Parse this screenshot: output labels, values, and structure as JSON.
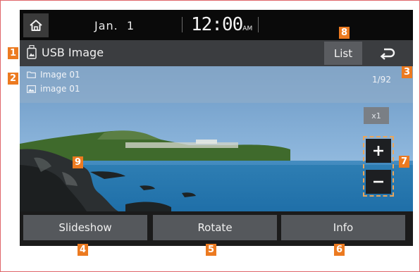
{
  "status_bar": {
    "date": "Jan.  1",
    "time": "12:00",
    "ampm": "AM"
  },
  "title_bar": {
    "title": "USB Image",
    "list_label": "List"
  },
  "file_info": {
    "folder": "Image 01",
    "image": "image 01",
    "counter": "1/92"
  },
  "zoom": {
    "level": "x1"
  },
  "bottom_bar": {
    "slideshow_label": "Slideshow",
    "rotate_label": "Rotate",
    "info_label": "Info"
  },
  "callouts": {
    "c1": "1",
    "c2": "2",
    "c3": "3",
    "c4": "4",
    "c5": "5",
    "c6": "6",
    "c7": "7",
    "c8": "8",
    "c9": "9"
  },
  "icons": {
    "home": "home-icon",
    "usb": "usb-image-icon",
    "back": "back-arrow-icon",
    "folder": "folder-icon",
    "image": "image-icon",
    "plus": "plus-icon",
    "minus": "minus-icon"
  },
  "colors": {
    "callout": "#ec7a20",
    "frame_border": "#e0656a",
    "zoom_highlight": "#e8a55c"
  }
}
